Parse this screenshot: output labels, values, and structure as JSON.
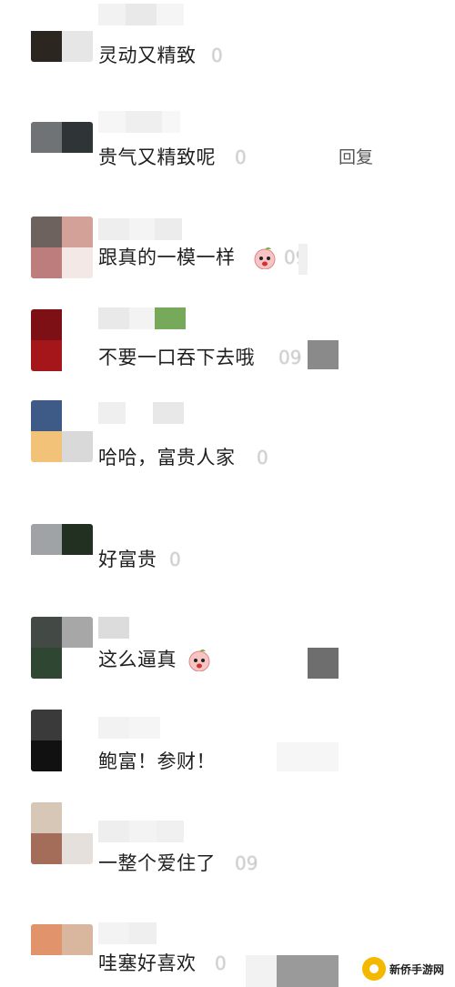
{
  "comments": [
    {
      "text": "灵动又精致",
      "time": "0",
      "reply": ""
    },
    {
      "text": "贵气又精致呢",
      "time": "0",
      "reply": "回复"
    },
    {
      "text": "跟真的一模一样",
      "time": "09",
      "reply": ""
    },
    {
      "text": "不要一口吞下去哦",
      "time": "09",
      "reply": ""
    },
    {
      "text": "哈哈，富贵人家",
      "time": "0",
      "reply": ""
    },
    {
      "text": "好富贵",
      "time": "0",
      "reply": ""
    },
    {
      "text": "这么逼真",
      "time": "",
      "reply": ""
    },
    {
      "text": "鲍富！参财！",
      "time": "",
      "reply": ""
    },
    {
      "text": "一整个爱住了",
      "time": "09",
      "reply": ""
    },
    {
      "text": "哇塞好喜欢",
      "time": "0",
      "reply": ""
    }
  ],
  "emoji_icon": "peach-face-emoji",
  "watermark": {
    "text": "新侨手游网"
  },
  "colors": {
    "text": "#1f1f1f",
    "time": "#c4c4c4",
    "reply": "#555555"
  }
}
